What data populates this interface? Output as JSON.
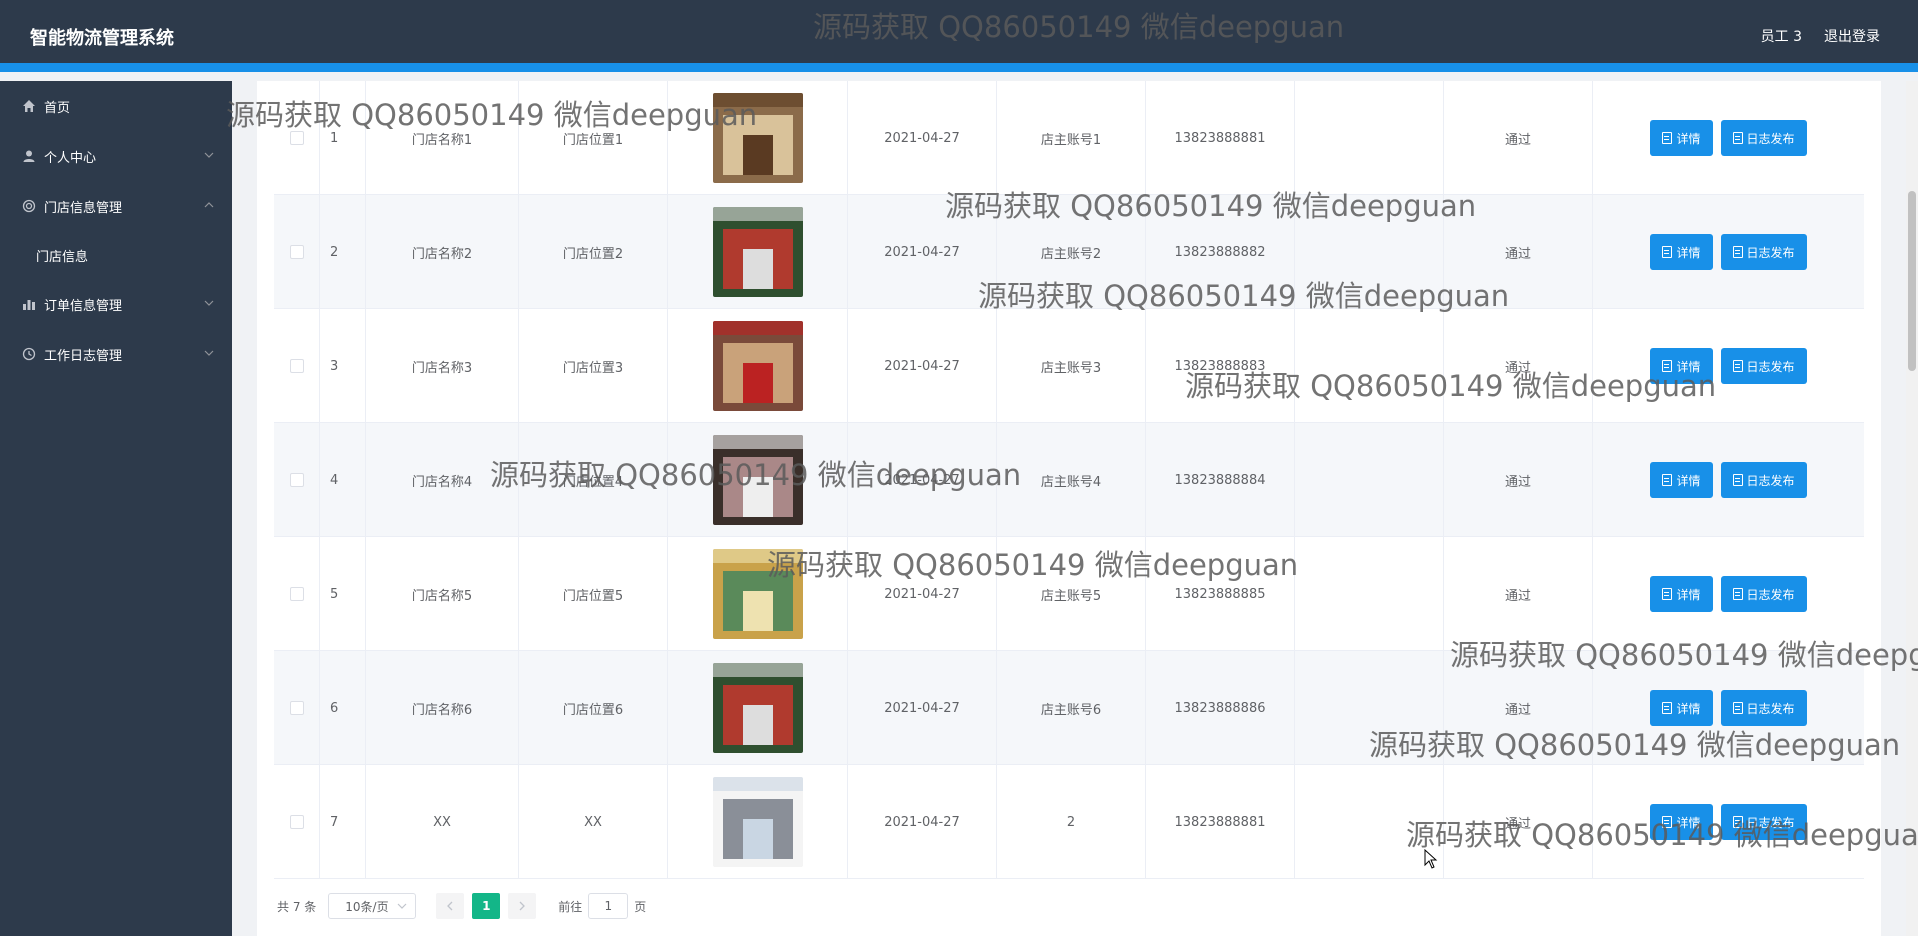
{
  "header": {
    "title": "智能物流管理系统",
    "user": "员工 3",
    "logout": "退出登录"
  },
  "sidebar": {
    "items": [
      {
        "label": "首页",
        "icon": "home-icon"
      },
      {
        "label": "个人中心",
        "icon": "user-icon"
      },
      {
        "label": "门店信息管理",
        "icon": "store-icon"
      },
      {
        "label": "门店信息",
        "icon": ""
      },
      {
        "label": "订单信息管理",
        "icon": "bar-chart-icon"
      },
      {
        "label": "工作日志管理",
        "icon": "clock-icon"
      }
    ]
  },
  "table": {
    "rows": [
      {
        "index": "1",
        "name": "门店名称1",
        "location": "门店位置1",
        "date": "2021-04-27",
        "account": "店主账号1",
        "phone": "13823888881",
        "status": "通过"
      },
      {
        "index": "2",
        "name": "门店名称2",
        "location": "门店位置2",
        "date": "2021-04-27",
        "account": "店主账号2",
        "phone": "13823888882",
        "status": "通过"
      },
      {
        "index": "3",
        "name": "门店名称3",
        "location": "门店位置3",
        "date": "2021-04-27",
        "account": "店主账号3",
        "phone": "13823888883",
        "status": "通过"
      },
      {
        "index": "4",
        "name": "门店名称4",
        "location": "门店位置4",
        "date": "2021-04-27",
        "account": "店主账号4",
        "phone": "13823888884",
        "status": "通过"
      },
      {
        "index": "5",
        "name": "门店名称5",
        "location": "门店位置5",
        "date": "2021-04-27",
        "account": "店主账号5",
        "phone": "13823888885",
        "status": "通过"
      },
      {
        "index": "6",
        "name": "门店名称6",
        "location": "门店位置6",
        "date": "2021-04-27",
        "account": "店主账号6",
        "phone": "13823888886",
        "status": "通过"
      },
      {
        "index": "7",
        "name": "XX",
        "location": "XX",
        "date": "2021-04-27",
        "account": "2",
        "phone": "13823888881",
        "status": "通过"
      }
    ],
    "detail_label": "详情",
    "log_label": "日志发布"
  },
  "pagination": {
    "total": "共 7 条",
    "page_size": "10条/页",
    "current": "1",
    "goto_prefix": "前往",
    "goto_value": "1",
    "goto_suffix": "页"
  },
  "watermark": "源码获取 QQ86050149 微信deepguan",
  "colors": {
    "header_bg": "#2d3a4b",
    "accent": "#1890e8",
    "page_active": "#13b688"
  }
}
